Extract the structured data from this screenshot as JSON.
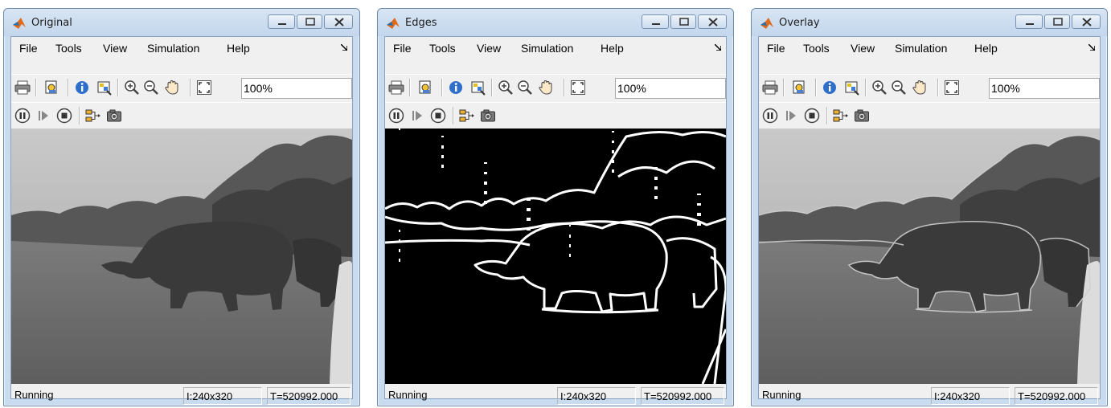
{
  "menu": [
    "File",
    "Tools",
    "View",
    "Simulation",
    "Help"
  ],
  "windows": [
    {
      "title": "Original",
      "zoom": "100%",
      "status": "Running",
      "size": "I:240x320",
      "time": "T=520992.000",
      "view": "original"
    },
    {
      "title": "Edges",
      "zoom": "100%",
      "status": "Running",
      "size": "I:240x320",
      "time": "T=520992.000",
      "view": "edges"
    },
    {
      "title": "Overlay",
      "zoom": "100%",
      "status": "Running",
      "size": "I:240x320",
      "time": "T=520992.000",
      "view": "overlay"
    }
  ],
  "toolbar_icons": [
    "print-icon",
    "highlight-block-icon",
    "info-icon",
    "colormap-icon",
    "zoom-in-icon",
    "zoom-out-icon",
    "pan-icon",
    "fit-to-view-icon"
  ],
  "playback_icons": [
    "pause-icon",
    "step-forward-icon",
    "stop-icon",
    "signal-select-icon",
    "snapshot-icon"
  ],
  "colors": {
    "frame": "#c9dbee",
    "client": "#f0f0f0",
    "matlab_orange": "#e16a1a"
  }
}
